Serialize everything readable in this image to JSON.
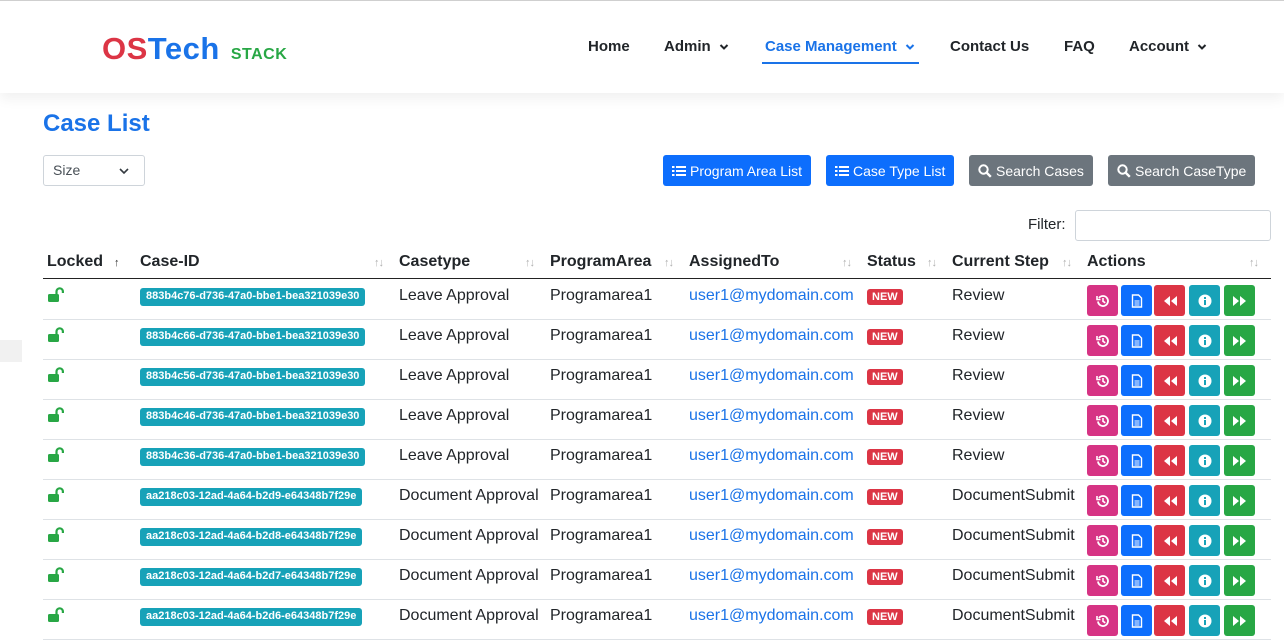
{
  "brand": {
    "part1": "OS",
    "part2": "Tech",
    "suffix": "STACK"
  },
  "nav": [
    {
      "label": "Home"
    },
    {
      "label": "Admin"
    },
    {
      "label": "Case Management"
    },
    {
      "label": "Contact Us"
    },
    {
      "label": "FAQ"
    },
    {
      "label": "Account"
    }
  ],
  "page": {
    "title": "Case List"
  },
  "size_select": {
    "value": "Size"
  },
  "buttons": {
    "program_area_list": "Program Area List",
    "case_type_list": "Case Type List",
    "search_cases": "Search Cases",
    "search_casetype": "Search CaseType"
  },
  "filter": {
    "label": "Filter:",
    "value": ""
  },
  "table": {
    "columns": [
      "Locked",
      "Case-ID",
      "Casetype",
      "ProgramArea",
      "AssignedTo",
      "Status",
      "Current Step",
      "Actions"
    ],
    "rows": [
      {
        "case_id": "883b4c76-d736-47a0-bbe1-bea321039e30",
        "casetype": "Leave Approval",
        "program_area": "Programarea1",
        "assigned_to": "user1@mydomain.com",
        "status": "NEW",
        "current_step": "Review"
      },
      {
        "case_id": "883b4c66-d736-47a0-bbe1-bea321039e30",
        "casetype": "Leave Approval",
        "program_area": "Programarea1",
        "assigned_to": "user1@mydomain.com",
        "status": "NEW",
        "current_step": "Review"
      },
      {
        "case_id": "883b4c56-d736-47a0-bbe1-bea321039e30",
        "casetype": "Leave Approval",
        "program_area": "Programarea1",
        "assigned_to": "user1@mydomain.com",
        "status": "NEW",
        "current_step": "Review"
      },
      {
        "case_id": "883b4c46-d736-47a0-bbe1-bea321039e30",
        "casetype": "Leave Approval",
        "program_area": "Programarea1",
        "assigned_to": "user1@mydomain.com",
        "status": "NEW",
        "current_step": "Review"
      },
      {
        "case_id": "883b4c36-d736-47a0-bbe1-bea321039e30",
        "casetype": "Leave Approval",
        "program_area": "Programarea1",
        "assigned_to": "user1@mydomain.com",
        "status": "NEW",
        "current_step": "Review"
      },
      {
        "case_id": "aa218c03-12ad-4a64-b2d9-e64348b7f29e",
        "casetype": "Document Approval",
        "program_area": "Programarea1",
        "assigned_to": "user1@mydomain.com",
        "status": "NEW",
        "current_step": "DocumentSubmit"
      },
      {
        "case_id": "aa218c03-12ad-4a64-b2d8-e64348b7f29e",
        "casetype": "Document Approval",
        "program_area": "Programarea1",
        "assigned_to": "user1@mydomain.com",
        "status": "NEW",
        "current_step": "DocumentSubmit"
      },
      {
        "case_id": "aa218c03-12ad-4a64-b2d7-e64348b7f29e",
        "casetype": "Document Approval",
        "program_area": "Programarea1",
        "assigned_to": "user1@mydomain.com",
        "status": "NEW",
        "current_step": "DocumentSubmit"
      },
      {
        "case_id": "aa218c03-12ad-4a64-b2d6-e64348b7f29e",
        "casetype": "Document Approval",
        "program_area": "Programarea1",
        "assigned_to": "user1@mydomain.com",
        "status": "NEW",
        "current_step": "DocumentSubmit"
      }
    ]
  },
  "row_actions": [
    "history-icon",
    "document-icon",
    "backward-icon",
    "info-icon",
    "forward-icon"
  ],
  "lock_icon": "unlock-icon",
  "colors": {
    "brand_red": "#dc3545",
    "brand_blue": "#1a73e8",
    "brand_green": "#28a745",
    "primary": "#0d6efd",
    "secondary": "#6c757d",
    "info": "#17a2b8",
    "pink": "#d63384"
  }
}
